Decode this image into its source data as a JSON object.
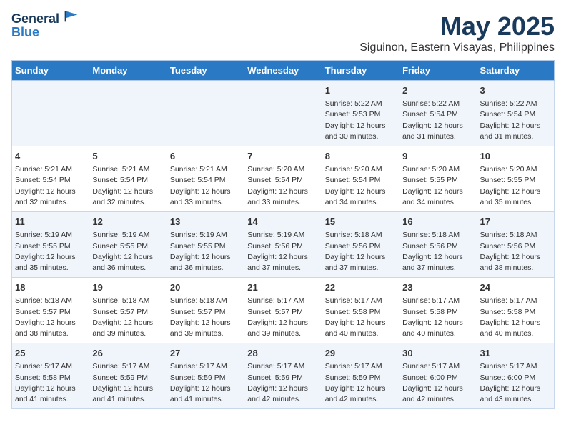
{
  "header": {
    "logo_line1": "General",
    "logo_line2": "Blue",
    "title": "May 2025",
    "subtitle": "Siguinon, Eastern Visayas, Philippines"
  },
  "days_of_week": [
    "Sunday",
    "Monday",
    "Tuesday",
    "Wednesday",
    "Thursday",
    "Friday",
    "Saturday"
  ],
  "weeks": [
    [
      {
        "day": "",
        "content": ""
      },
      {
        "day": "",
        "content": ""
      },
      {
        "day": "",
        "content": ""
      },
      {
        "day": "",
        "content": ""
      },
      {
        "day": "1",
        "content": "Sunrise: 5:22 AM\nSunset: 5:53 PM\nDaylight: 12 hours\nand 30 minutes."
      },
      {
        "day": "2",
        "content": "Sunrise: 5:22 AM\nSunset: 5:54 PM\nDaylight: 12 hours\nand 31 minutes."
      },
      {
        "day": "3",
        "content": "Sunrise: 5:22 AM\nSunset: 5:54 PM\nDaylight: 12 hours\nand 31 minutes."
      }
    ],
    [
      {
        "day": "4",
        "content": "Sunrise: 5:21 AM\nSunset: 5:54 PM\nDaylight: 12 hours\nand 32 minutes."
      },
      {
        "day": "5",
        "content": "Sunrise: 5:21 AM\nSunset: 5:54 PM\nDaylight: 12 hours\nand 32 minutes."
      },
      {
        "day": "6",
        "content": "Sunrise: 5:21 AM\nSunset: 5:54 PM\nDaylight: 12 hours\nand 33 minutes."
      },
      {
        "day": "7",
        "content": "Sunrise: 5:20 AM\nSunset: 5:54 PM\nDaylight: 12 hours\nand 33 minutes."
      },
      {
        "day": "8",
        "content": "Sunrise: 5:20 AM\nSunset: 5:54 PM\nDaylight: 12 hours\nand 34 minutes."
      },
      {
        "day": "9",
        "content": "Sunrise: 5:20 AM\nSunset: 5:55 PM\nDaylight: 12 hours\nand 34 minutes."
      },
      {
        "day": "10",
        "content": "Sunrise: 5:20 AM\nSunset: 5:55 PM\nDaylight: 12 hours\nand 35 minutes."
      }
    ],
    [
      {
        "day": "11",
        "content": "Sunrise: 5:19 AM\nSunset: 5:55 PM\nDaylight: 12 hours\nand 35 minutes."
      },
      {
        "day": "12",
        "content": "Sunrise: 5:19 AM\nSunset: 5:55 PM\nDaylight: 12 hours\nand 36 minutes."
      },
      {
        "day": "13",
        "content": "Sunrise: 5:19 AM\nSunset: 5:55 PM\nDaylight: 12 hours\nand 36 minutes."
      },
      {
        "day": "14",
        "content": "Sunrise: 5:19 AM\nSunset: 5:56 PM\nDaylight: 12 hours\nand 37 minutes."
      },
      {
        "day": "15",
        "content": "Sunrise: 5:18 AM\nSunset: 5:56 PM\nDaylight: 12 hours\nand 37 minutes."
      },
      {
        "day": "16",
        "content": "Sunrise: 5:18 AM\nSunset: 5:56 PM\nDaylight: 12 hours\nand 37 minutes."
      },
      {
        "day": "17",
        "content": "Sunrise: 5:18 AM\nSunset: 5:56 PM\nDaylight: 12 hours\nand 38 minutes."
      }
    ],
    [
      {
        "day": "18",
        "content": "Sunrise: 5:18 AM\nSunset: 5:57 PM\nDaylight: 12 hours\nand 38 minutes."
      },
      {
        "day": "19",
        "content": "Sunrise: 5:18 AM\nSunset: 5:57 PM\nDaylight: 12 hours\nand 39 minutes."
      },
      {
        "day": "20",
        "content": "Sunrise: 5:18 AM\nSunset: 5:57 PM\nDaylight: 12 hours\nand 39 minutes."
      },
      {
        "day": "21",
        "content": "Sunrise: 5:17 AM\nSunset: 5:57 PM\nDaylight: 12 hours\nand 39 minutes."
      },
      {
        "day": "22",
        "content": "Sunrise: 5:17 AM\nSunset: 5:58 PM\nDaylight: 12 hours\nand 40 minutes."
      },
      {
        "day": "23",
        "content": "Sunrise: 5:17 AM\nSunset: 5:58 PM\nDaylight: 12 hours\nand 40 minutes."
      },
      {
        "day": "24",
        "content": "Sunrise: 5:17 AM\nSunset: 5:58 PM\nDaylight: 12 hours\nand 40 minutes."
      }
    ],
    [
      {
        "day": "25",
        "content": "Sunrise: 5:17 AM\nSunset: 5:58 PM\nDaylight: 12 hours\nand 41 minutes."
      },
      {
        "day": "26",
        "content": "Sunrise: 5:17 AM\nSunset: 5:59 PM\nDaylight: 12 hours\nand 41 minutes."
      },
      {
        "day": "27",
        "content": "Sunrise: 5:17 AM\nSunset: 5:59 PM\nDaylight: 12 hours\nand 41 minutes."
      },
      {
        "day": "28",
        "content": "Sunrise: 5:17 AM\nSunset: 5:59 PM\nDaylight: 12 hours\nand 42 minutes."
      },
      {
        "day": "29",
        "content": "Sunrise: 5:17 AM\nSunset: 5:59 PM\nDaylight: 12 hours\nand 42 minutes."
      },
      {
        "day": "30",
        "content": "Sunrise: 5:17 AM\nSunset: 6:00 PM\nDaylight: 12 hours\nand 42 minutes."
      },
      {
        "day": "31",
        "content": "Sunrise: 5:17 AM\nSunset: 6:00 PM\nDaylight: 12 hours\nand 43 minutes."
      }
    ]
  ]
}
